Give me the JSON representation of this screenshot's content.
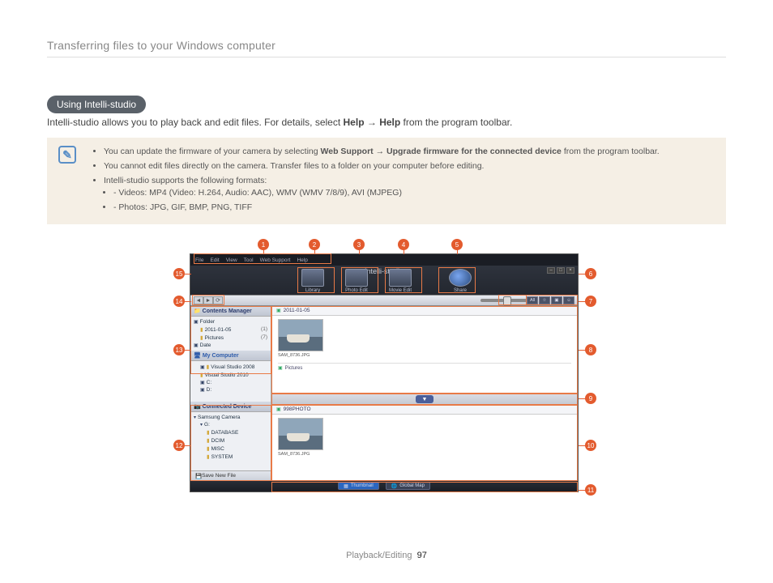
{
  "header": {
    "title": "Transferring files to your Windows computer"
  },
  "section": {
    "pill": "Using Intelli-studio"
  },
  "intro": {
    "pre": "Intelli-studio allows you to play back and edit files. For details, select ",
    "b1": "Help",
    "arrow": " → ",
    "b2": "Help",
    "post": " from the program toolbar."
  },
  "notes": {
    "n1_pre": "You can update the firmware of your camera by selecting ",
    "n1_b1": "Web Support",
    "n1_arrow": " → ",
    "n1_b2": "Upgrade firmware for the connected device",
    "n1_post": " from the program toolbar.",
    "n2": "You cannot edit files directly on the camera. Transfer files to a folder on your computer before editing.",
    "n3": "Intelli-studio supports the following formats:",
    "n3a": "Videos: MP4 (Video: H.264, Audio: AAC), WMV (WMV 7/8/9), AVI (MJPEG)",
    "n3b": "Photos: JPG, GIF, BMP, PNG, TIFF"
  },
  "app": {
    "title": "Intelli-studio",
    "menus": [
      "File",
      "Edit",
      "View",
      "Tool",
      "Web Support",
      "Help"
    ],
    "win": {
      "min": "–",
      "max": "□",
      "close": "×"
    },
    "modes": {
      "library": "Library",
      "photo": "Photo Edit",
      "movie": "Movie Edit",
      "share": "Share"
    },
    "filter_all": "All",
    "sidebar": {
      "contents": "Contents Manager",
      "folder": "Folder",
      "date_2011": "2011-01-05",
      "date_2011_cnt": "(1)",
      "pictures": "Pictures",
      "pictures_cnt": "(7)",
      "date": "Date",
      "mycomputer": "My Computer",
      "vs2008": "Visual Studio 2008",
      "vs2010": "Visual Studio 2010",
      "drive_c": "C:",
      "drive_d": "D:",
      "connected": "Connected Device",
      "samsung": "Samsung Camera",
      "drive_g": "G:",
      "database": "DATABASE",
      "dcim": "DCIM",
      "misc": "MISC",
      "system": "SYSTEM",
      "save_new": "Save New File"
    },
    "panel": {
      "path_top": "2011-01-05",
      "thumb_name": "SAM_8736.JPG",
      "sub_pictures": "Pictures",
      "path_bottom": "998PHOTO",
      "thumb_name2": "SAM_8736.JPG"
    },
    "bottom": {
      "thumbnail": "Thumbnail",
      "globalmap": "Global Map"
    }
  },
  "callouts": {
    "c1": "1",
    "c2": "2",
    "c3": "3",
    "c4": "4",
    "c5": "5",
    "c6": "6",
    "c7": "7",
    "c8": "8",
    "c9": "9",
    "c10": "10",
    "c11": "11",
    "c12": "12",
    "c13": "13",
    "c14": "14",
    "c15": "15"
  },
  "footer": {
    "section": "Playback/Editing",
    "page": "97"
  }
}
